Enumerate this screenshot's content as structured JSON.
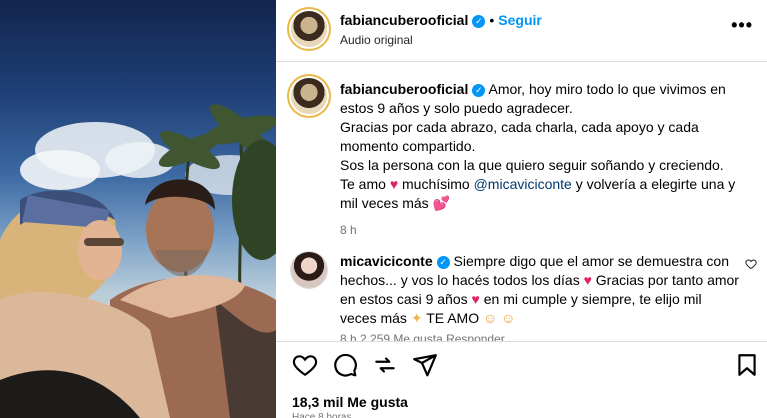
{
  "post": {
    "username": "fabiancuberooficial",
    "follow_label": "Seguir",
    "separator": "•",
    "audio_label": "Audio original",
    "more_label": "•••"
  },
  "caption": {
    "username": "fabiancuberooficial",
    "line1": "Amor, hoy miro todo lo que vivimos en estos 9 años y solo puedo agradecer.",
    "line2": "Gracias por cada abrazo, cada charla, cada apoyo y cada momento compartido.",
    "line3": "Sos la persona con la que quiero seguir soñando y creciendo.",
    "line4_a": "Te amo",
    "line4_b": "muchísimo",
    "mention": "@micaviciconte",
    "line4_c": "y volvería a elegirte una y mil veces más",
    "time": "8 h"
  },
  "comment": {
    "username": "micaviciconte",
    "text_a": "Siempre digo que el amor se demuestra con hechos... y vos lo hacés todos los días",
    "text_b": "Gracias por tanto amor en estos casi 9 años",
    "text_c": "en mi cumple y siempre, te elijo mil veces más",
    "text_d": "TE AMO",
    "meta": "8 h   2.259 Me gusta   Responder"
  },
  "engagement": {
    "likes": "18,3 mil Me gusta",
    "date": "Hace 8 horas"
  },
  "icons": {
    "verified": "verified-badge-icon",
    "like": "heart-icon",
    "comment": "comment-icon",
    "share": "share-icon",
    "send": "send-icon",
    "save": "bookmark-icon"
  },
  "colors": {
    "accent": "#0095f6",
    "heart": "#e0245e",
    "muted": "#737373"
  }
}
